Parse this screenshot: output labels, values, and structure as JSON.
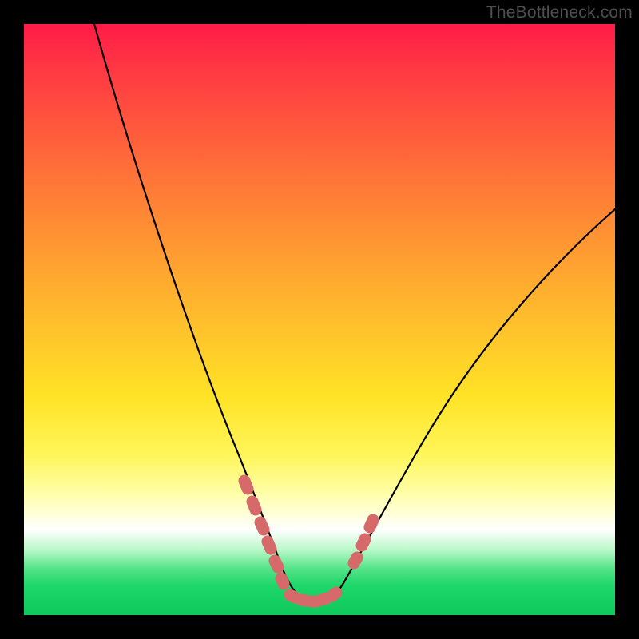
{
  "watermark": "TheBottleneck.com",
  "colors": {
    "curve_stroke": "#000000",
    "marker_fill": "#d66a6a",
    "marker_stroke": "#d66a6a",
    "page_bg": "#000000"
  },
  "chart_data": {
    "type": "line",
    "title": "",
    "xlabel": "",
    "ylabel": "",
    "xlim": [
      0,
      100
    ],
    "ylim": [
      0,
      100
    ],
    "grid": false,
    "legend": false,
    "note": "No axes, ticks, or numeric labels are rendered; values below are pixel-estimated from gridless visual positions on a 0–100 × 0–100 canvas (x right, y up).",
    "series": [
      {
        "name": "bottleneck-curve",
        "style": "thin black line",
        "x": [
          12,
          15,
          18,
          22,
          26,
          30,
          34,
          37,
          39,
          41,
          43,
          45,
          48,
          51,
          52,
          55,
          59,
          64,
          70,
          77,
          85,
          93,
          100
        ],
        "y": [
          100,
          89,
          78,
          66,
          55,
          44,
          33,
          24,
          17,
          11,
          6,
          3,
          1,
          1,
          2,
          5,
          10,
          18,
          28,
          40,
          52,
          62,
          70
        ]
      },
      {
        "name": "marker-cluster-left",
        "style": "rounded salmon markers along descending leg",
        "type": "scatter",
        "x": [
          37.0,
          38.3,
          39.5,
          40.6,
          41.8,
          42.8
        ],
        "y": [
          22.0,
          18.0,
          14.2,
          10.5,
          7.2,
          4.5
        ]
      },
      {
        "name": "marker-cluster-bottom",
        "style": "rounded salmon markers along valley floor",
        "type": "scatter",
        "x": [
          44.5,
          46.5,
          48.5,
          50.5,
          52.0
        ],
        "y": [
          2.3,
          1.5,
          1.2,
          1.5,
          2.2
        ]
      },
      {
        "name": "marker-cluster-right",
        "style": "rounded salmon markers on ascending leg",
        "type": "scatter",
        "x": [
          55.5,
          57.0,
          58.5
        ],
        "y": [
          8.0,
          11.5,
          15.0
        ]
      }
    ]
  }
}
